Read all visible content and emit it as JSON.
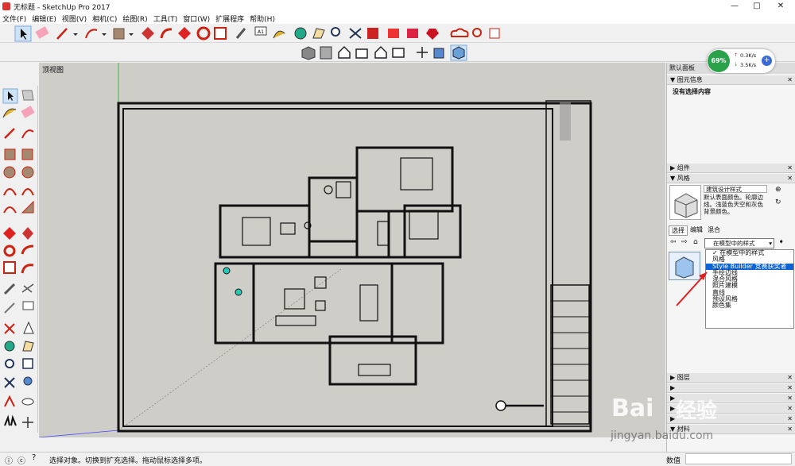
{
  "window": {
    "title": "无标题 - SketchUp Pro 2017"
  },
  "menu": [
    "文件(F)",
    "编辑(E)",
    "视图(V)",
    "相机(C)",
    "绘图(R)",
    "工具(T)",
    "窗口(W)",
    "扩展程序",
    "帮助(H)"
  ],
  "viewport": {
    "label": "顶视图"
  },
  "tray": {
    "title": "默认面板"
  },
  "entity_info": {
    "title": "图元信息",
    "content": "没有选择内容"
  },
  "components": {
    "title": "组件"
  },
  "styles": {
    "title": "风格",
    "style_name": "建筑设计样式",
    "style_desc": "默认表面颜色。轮廓边线。浅蓝色天空和灰色背景颜色。",
    "tabs": [
      "选择",
      "编辑",
      "混合"
    ],
    "dropdown_value": "在模型中的样式",
    "options": [
      {
        "label": "✓ 在模型中的样式",
        "highlight": false
      },
      {
        "label": "风格",
        "highlight": false
      },
      {
        "label": "Style Builder 竞赛获奖者",
        "highlight": true
      },
      {
        "label": "手绘边线",
        "highlight": false
      },
      {
        "label": "混合风格",
        "highlight": false
      },
      {
        "label": "照片建模",
        "highlight": false
      },
      {
        "label": "直线",
        "highlight": false
      },
      {
        "label": "预设风格",
        "highlight": false
      },
      {
        "label": "颜色集",
        "highlight": false
      }
    ]
  },
  "layers": {
    "title": "图层"
  },
  "materials": {
    "title": "材料"
  },
  "network": {
    "percent": "69%",
    "up": "0.3K/s",
    "down": "3.5K/s"
  },
  "status": {
    "message": "选择对象。切换到扩充选择。拖动鼠标选择多项。",
    "measure_label": "数值"
  },
  "watermark": {
    "brand": "Bai",
    "brand2": "经验",
    "url": "jingyan.baidu.com"
  }
}
